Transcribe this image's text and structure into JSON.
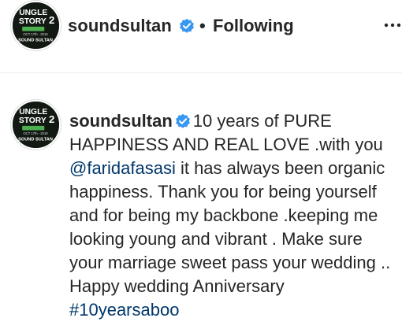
{
  "post": {
    "username": "soundsultan",
    "dot": "•",
    "follow_status": "Following",
    "more_label": "More options"
  },
  "avatar": {
    "line1": "UNGLE",
    "line2": "STORY",
    "badge": "2",
    "small": "OCT 17th - 2019",
    "foot": "SOUND SULTAN"
  },
  "comment": {
    "username": "soundsultan",
    "text_before_mention": "10 years of PURE HAPPINESS AND REAL LOVE .with you ",
    "mention": "@faridafasasi",
    "text_after_mention": " it has always been organic happiness. Thank you for being yourself and for being my backbone .keeping me looking young and vibrant . Make sure your marriage sweet pass your wedding .. Happy wedding Anniversary ",
    "hashtag": "#10yearsaboo"
  },
  "colors": {
    "verified": "#3897f0",
    "link": "#00376b",
    "text": "#262626",
    "avatar_accent": "#4caf50"
  },
  "icons": {
    "verified": "verified-badge-icon",
    "more": "more-options-icon"
  }
}
